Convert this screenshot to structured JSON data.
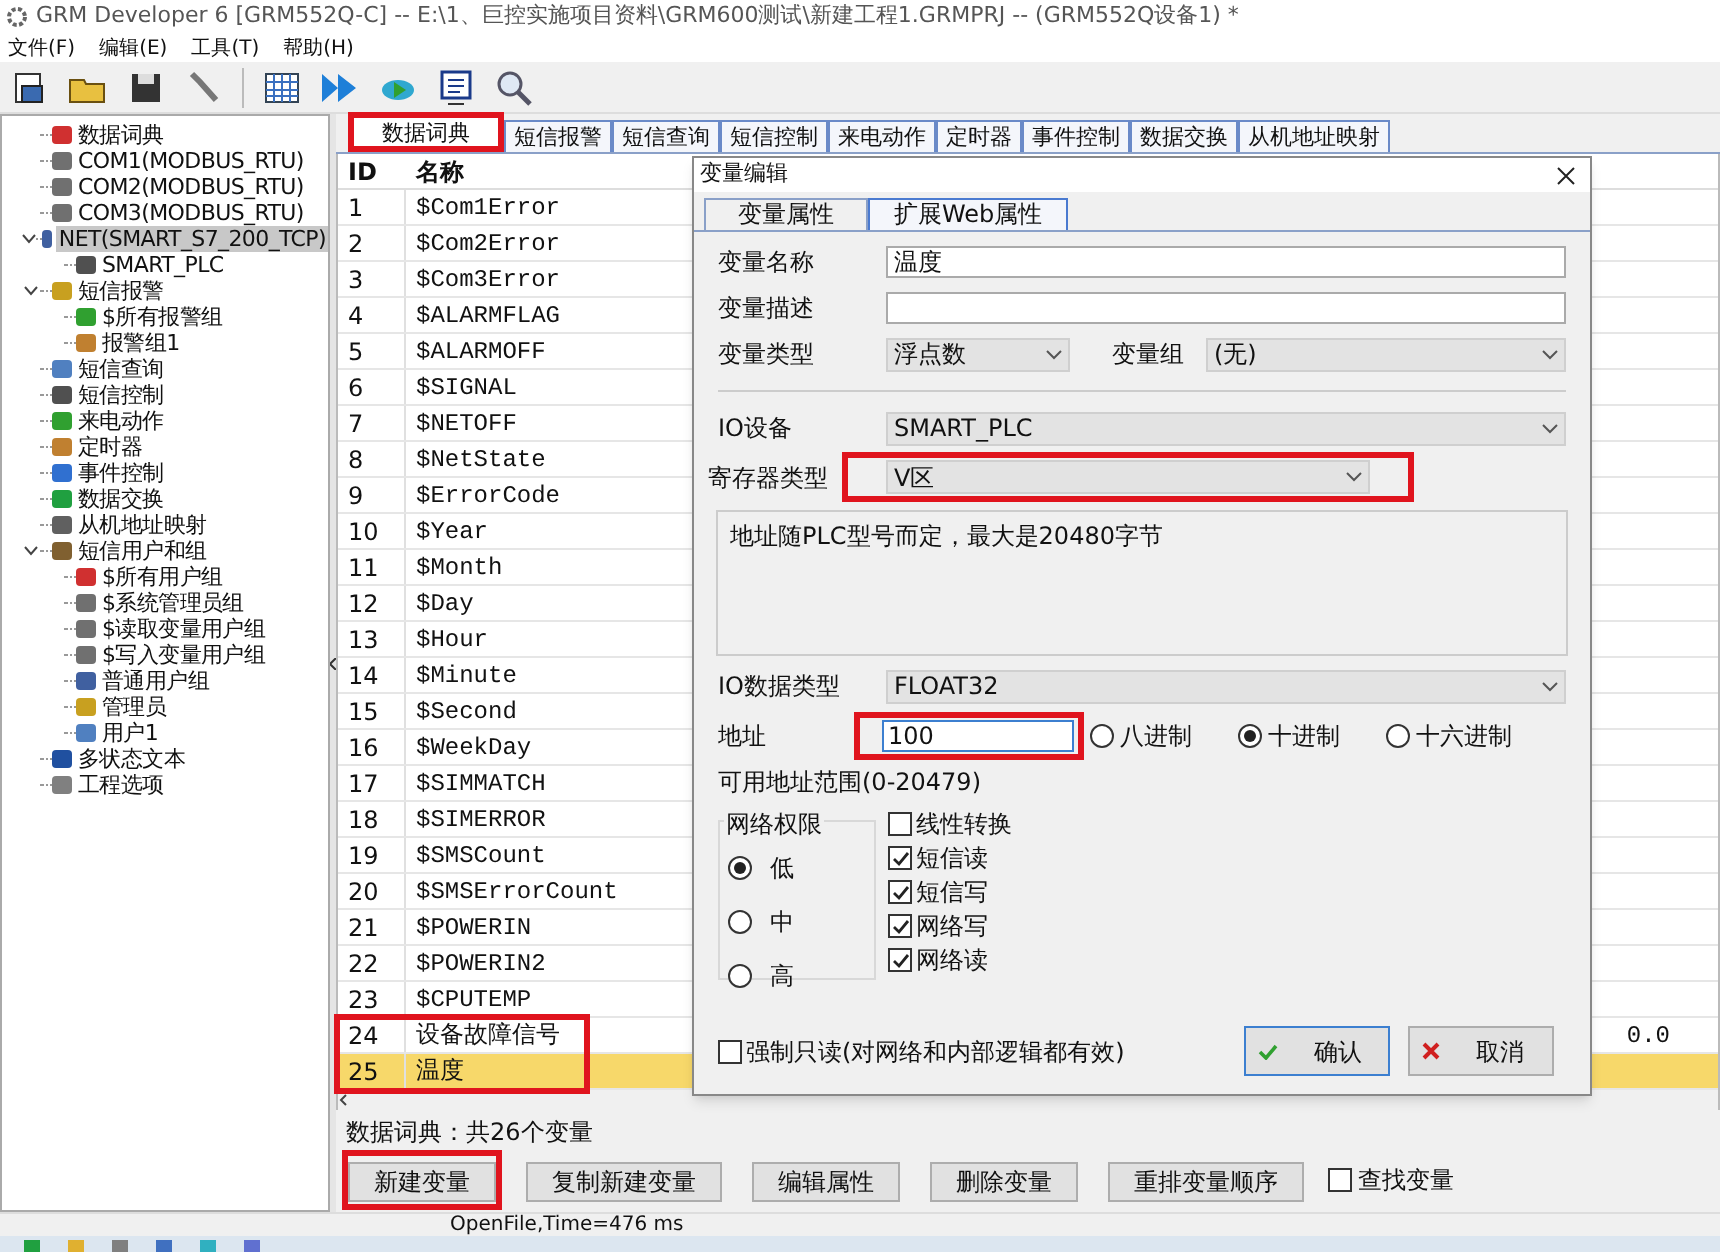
{
  "window": {
    "title": "GRM Developer 6 [GRM552Q-C]  -- E:\\1、巨控实施项目资料\\GRM600测试\\新建工程1.GRMPRJ -- (GRM552Q设备1) *"
  },
  "menu": [
    "文件(F)",
    "编辑(E)",
    "工具(T)",
    "帮助(H)"
  ],
  "tree": [
    {
      "label": "数据词典",
      "selected": false
    },
    {
      "label": "COM1(MODBUS_RTU)",
      "selected": false
    },
    {
      "label": "COM2(MODBUS_RTU)",
      "selected": false
    },
    {
      "label": "COM3(MODBUS_RTU)",
      "selected": false
    },
    {
      "label": "NET(SMART_S7_200_TCP)",
      "selected": true,
      "expanded": true,
      "children": [
        {
          "label": "SMART_PLC",
          "selected": false
        }
      ]
    },
    {
      "label": "短信报警",
      "selected": false,
      "expanded": true,
      "children": [
        {
          "label": "$所有报警组",
          "selected": false
        },
        {
          "label": "报警组1",
          "selected": false
        }
      ]
    },
    {
      "label": "短信查询",
      "selected": false
    },
    {
      "label": "短信控制",
      "selected": false
    },
    {
      "label": "来电动作",
      "selected": false
    },
    {
      "label": "定时器",
      "selected": false
    },
    {
      "label": "事件控制",
      "selected": false
    },
    {
      "label": "数据交换",
      "selected": false
    },
    {
      "label": "从机地址映射",
      "selected": false
    },
    {
      "label": "短信用户和组",
      "selected": false,
      "expanded": true,
      "children": [
        {
          "label": "$所有用户组",
          "selected": false
        },
        {
          "label": "$系统管理员组",
          "selected": false
        },
        {
          "label": "$读取变量用户组",
          "selected": false
        },
        {
          "label": "$写入变量用户组",
          "selected": false
        },
        {
          "label": "普通用户组",
          "selected": false
        },
        {
          "label": "管理员",
          "selected": false
        },
        {
          "label": "用户1",
          "selected": false
        }
      ]
    },
    {
      "label": "多状态文本",
      "selected": false
    },
    {
      "label": "工程选项",
      "selected": false
    }
  ],
  "tabs": [
    {
      "label": "数据词典",
      "selected": true,
      "annotated": true
    },
    {
      "label": "短信报警",
      "selected": false,
      "annotated": false
    },
    {
      "label": "短信查询",
      "selected": false,
      "annotated": false
    },
    {
      "label": "短信控制",
      "selected": false,
      "annotated": false
    },
    {
      "label": "来电动作",
      "selected": false,
      "annotated": false
    },
    {
      "label": "定时器",
      "selected": false,
      "annotated": false
    },
    {
      "label": "事件控制",
      "selected": false,
      "annotated": false
    },
    {
      "label": "数据交换",
      "selected": false,
      "annotated": false
    },
    {
      "label": "从机地址映射",
      "selected": false,
      "annotated": false
    }
  ],
  "table": {
    "columns": [
      "ID",
      "名称"
    ],
    "rows": [
      {
        "id": "1",
        "name": "$Com1Error",
        "selected": false,
        "annotated": false
      },
      {
        "id": "2",
        "name": "$Com2Error",
        "selected": false,
        "annotated": false
      },
      {
        "id": "3",
        "name": "$Com3Error",
        "selected": false,
        "annotated": false
      },
      {
        "id": "4",
        "name": "$ALARMFLAG",
        "selected": false,
        "annotated": false
      },
      {
        "id": "5",
        "name": "$ALARMOFF",
        "selected": false,
        "annotated": false
      },
      {
        "id": "6",
        "name": "$SIGNAL",
        "selected": false,
        "annotated": false
      },
      {
        "id": "7",
        "name": "$NETOFF",
        "selected": false,
        "annotated": false
      },
      {
        "id": "8",
        "name": "$NetState",
        "selected": false,
        "annotated": false
      },
      {
        "id": "9",
        "name": "$ErrorCode",
        "selected": false,
        "annotated": false
      },
      {
        "id": "10",
        "name": "$Year",
        "selected": false,
        "annotated": false
      },
      {
        "id": "11",
        "name": "$Month",
        "selected": false,
        "annotated": false
      },
      {
        "id": "12",
        "name": "$Day",
        "selected": false,
        "annotated": false
      },
      {
        "id": "13",
        "name": "$Hour",
        "selected": false,
        "annotated": false
      },
      {
        "id": "14",
        "name": "$Minute",
        "selected": false,
        "annotated": false
      },
      {
        "id": "15",
        "name": "$Second",
        "selected": false,
        "annotated": false
      },
      {
        "id": "16",
        "name": "$WeekDay",
        "selected": false,
        "annotated": false
      },
      {
        "id": "17",
        "name": "$SIMMATCH",
        "selected": false,
        "annotated": false
      },
      {
        "id": "18",
        "name": "$SIMERROR",
        "selected": false,
        "annotated": false
      },
      {
        "id": "19",
        "name": "$SMSCount",
        "selected": false,
        "annotated": false
      },
      {
        "id": "20",
        "name": "$SMSErrorCount",
        "selected": false,
        "annotated": false
      },
      {
        "id": "21",
        "name": "$POWERIN",
        "selected": false,
        "annotated": false
      },
      {
        "id": "22",
        "name": "$POWERIN2",
        "selected": false,
        "annotated": false
      },
      {
        "id": "23",
        "name": "$CPUTEMP",
        "selected": false,
        "annotated": false
      },
      {
        "id": "24",
        "name": "设备故障信号",
        "value": "0.0",
        "selected": false,
        "annotated": true
      },
      {
        "id": "25",
        "name": "温度",
        "selected": true,
        "annotated": true
      }
    ]
  },
  "summary": "数据词典：共26个变量",
  "buttons": [
    {
      "label": "新建变量",
      "annotated": true
    },
    {
      "label": "复制新建变量",
      "annotated": false
    },
    {
      "label": "编辑属性",
      "annotated": false
    },
    {
      "label": "删除变量",
      "annotated": false
    },
    {
      "label": "重排变量顺序",
      "annotated": false
    }
  ],
  "find": {
    "label": "查找变量",
    "checked": false
  },
  "status_bar": "OpenFile,Time=476 ms",
  "dialog": {
    "title": "变量编辑",
    "tabs": [
      {
        "label": "变量属性",
        "selected": true
      },
      {
        "label": "扩展Web属性",
        "selected": false
      }
    ],
    "name": {
      "label": "变量名称",
      "value": "温度"
    },
    "description": {
      "label": "变量描述"
    },
    "type": {
      "label": "变量类型",
      "value": "浮点数"
    },
    "group": {
      "label": "变量组",
      "value": "(无)"
    },
    "io_device": {
      "label": "IO设备",
      "value": "SMART_PLC"
    },
    "register_type": {
      "label": "寄存器类型",
      "value": "V区",
      "annotated": true
    },
    "note": "地址随PLC型号而定，最大是20480字节",
    "io_data_type": {
      "label": "IO数据类型",
      "value": "FLOAT32"
    },
    "address": {
      "label": "地址",
      "value": "100",
      "annotated": true
    },
    "radix": [
      {
        "label": "八进制",
        "selected": false
      },
      {
        "label": "十进制",
        "selected": true
      },
      {
        "label": "十六进制",
        "selected": false
      }
    ],
    "range": "可用地址范围(0-20479)",
    "permission": {
      "title": "网络权限",
      "options": [
        {
          "label": "低",
          "selected": true
        },
        {
          "label": "中",
          "selected": false
        },
        {
          "label": "高",
          "selected": false
        }
      ]
    },
    "options": [
      {
        "label": "线性转换",
        "checked": false
      },
      {
        "label": "短信读",
        "checked": true
      },
      {
        "label": "短信写",
        "checked": true
      },
      {
        "label": "网络写",
        "checked": true
      },
      {
        "label": "网络读",
        "checked": true
      }
    ],
    "read_only": {
      "label": "强制只读(对网络和内部逻辑都有效)",
      "checked": false
    },
    "ok": "确认",
    "cancel": "取消"
  }
}
